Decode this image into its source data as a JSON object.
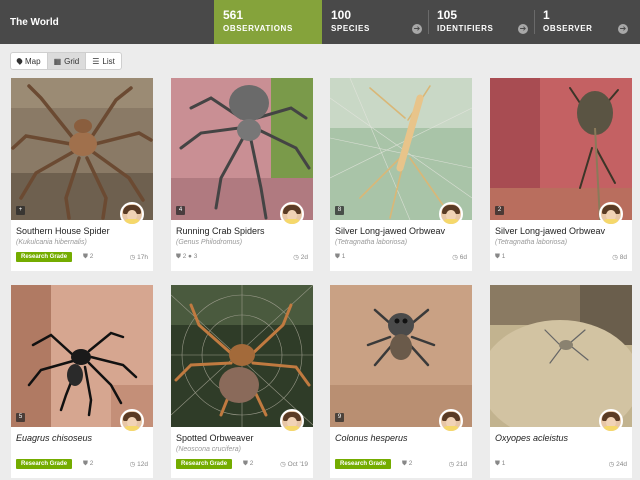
{
  "header": {
    "place": "The World",
    "stats": [
      {
        "number": "561",
        "label": "OBSERVATIONS"
      },
      {
        "number": "100",
        "label": "SPECIES"
      },
      {
        "number": "105",
        "label": "IDENTIFIERS"
      },
      {
        "number": "1",
        "label": "OBSERVER"
      }
    ],
    "arrow_glyph": "➔"
  },
  "views": {
    "map": "Map",
    "grid": "Grid",
    "list": "List"
  },
  "colors": {
    "accent": "#85a33b",
    "research_grade": "#74ac00",
    "header_bg": "#494949"
  },
  "observations": [
    {
      "count": "+",
      "name": "Southern House Spider",
      "scientific": "(Kukulcania hibernalis)",
      "badge": "Research Grade",
      "ids": "2",
      "comments": "",
      "time": "17h",
      "photo_icon": "spider-photo"
    },
    {
      "count": "4",
      "name": "Running Crab Spiders",
      "scientific": "(Genus Philodromus)",
      "badge": "",
      "ids": "2",
      "comments": "3",
      "time": "2d",
      "photo_icon": "spider-photo"
    },
    {
      "count": "8",
      "name": "Silver Long-jawed Orbweaver",
      "scientific": "(Tetragnatha laboriosa)",
      "badge": "",
      "ids": "1",
      "comments": "",
      "time": "6d",
      "photo_icon": "spider-photo"
    },
    {
      "count": "2",
      "name": "Silver Long-jawed Orbweaver",
      "scientific": "(Tetragnatha laboriosa)",
      "badge": "",
      "ids": "1",
      "comments": "",
      "time": "8d",
      "photo_icon": "spider-photo"
    },
    {
      "count": "5",
      "name": "Euagrus chisoseus",
      "scientific": "",
      "badge": "Research Grade",
      "ids": "2",
      "comments": "",
      "time": "12d",
      "photo_icon": "spider-photo"
    },
    {
      "count": "",
      "name": "Spotted Orbweaver",
      "scientific": "(Neoscona crucifera)",
      "badge": "Research Grade",
      "ids": "2",
      "comments": "",
      "time": "Oct '19",
      "photo_icon": "spider-photo"
    },
    {
      "count": "9",
      "name": "Colonus hesperus",
      "scientific": "",
      "badge": "Research Grade",
      "ids": "2",
      "comments": "",
      "time": "21d",
      "photo_icon": "spider-photo"
    },
    {
      "count": "",
      "name": "Oxyopes acleistus",
      "scientific": "",
      "badge": "",
      "ids": "1",
      "comments": "",
      "time": "24d",
      "photo_icon": "spider-photo"
    }
  ],
  "icons": {
    "id_icon": "⛊",
    "comment_icon": "●",
    "clock_icon": "◷",
    "map_icon": "⬤",
    "grid_icon": "▦",
    "list_icon": "☰"
  }
}
